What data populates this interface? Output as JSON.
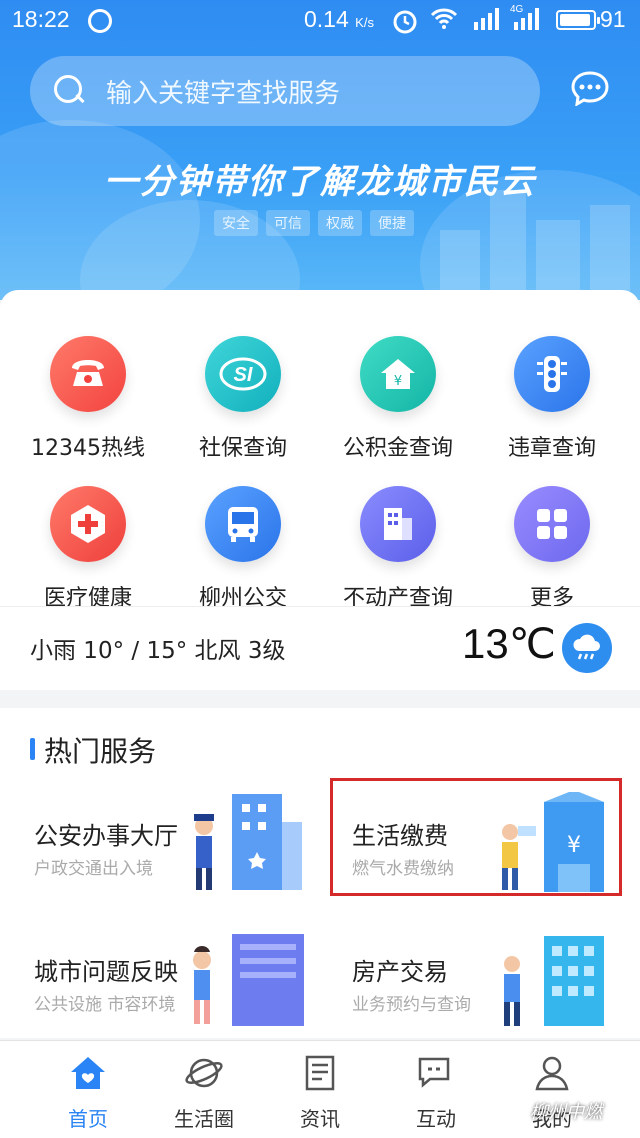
{
  "status": {
    "time": "18:22",
    "speed": "0.14",
    "speed_unit": "K/s",
    "network": "4G",
    "battery": "91"
  },
  "search": {
    "placeholder": "输入关键字查找服务"
  },
  "banner": {
    "title": "一分钟带你了解龙城市民云",
    "tags": [
      "安全",
      "可信",
      "权威",
      "便捷"
    ]
  },
  "grid": [
    {
      "label": "12345热线",
      "icon": "phone-icon",
      "color": "#f5524e"
    },
    {
      "label": "社保查询",
      "icon": "social-security-icon",
      "color": "#1fc1c9"
    },
    {
      "label": "公积金查询",
      "icon": "house-fund-icon",
      "color": "#22c7b7"
    },
    {
      "label": "违章查询",
      "icon": "traffic-light-icon",
      "color": "#3a86f2"
    },
    {
      "label": "医疗健康",
      "icon": "medical-cross-icon",
      "color": "#f2544c"
    },
    {
      "label": "柳州公交",
      "icon": "bus-icon",
      "color": "#2f85ef"
    },
    {
      "label": "不动产查询",
      "icon": "building-icon",
      "color": "#6f74ef"
    },
    {
      "label": "更多",
      "icon": "grid-more-icon",
      "color": "#7c79f2"
    }
  ],
  "weather": {
    "text": "小雨  10° / 15°  北风 3级",
    "temp": "13℃",
    "icon": "rain-cloud-icon"
  },
  "hot": {
    "title": "热门服务",
    "items": [
      {
        "title": "公安办事大厅",
        "sub": "户政交通出入境"
      },
      {
        "title": "生活缴费",
        "sub": "燃气水费缴纳"
      },
      {
        "title": "城市问题反映",
        "sub": "公共设施 市容环境"
      },
      {
        "title": "房产交易",
        "sub": "业务预约与查询"
      }
    ]
  },
  "tabs": [
    {
      "label": "首页",
      "icon": "home-icon"
    },
    {
      "label": "生活圈",
      "icon": "planet-icon"
    },
    {
      "label": "资讯",
      "icon": "news-icon"
    },
    {
      "label": "互动",
      "icon": "chat-icon"
    },
    {
      "label": "我的",
      "icon": "user-icon"
    }
  ],
  "watermark": "柳州中燃",
  "colors": {
    "accent": "#2a84f5",
    "highlight": "#d42a2a"
  }
}
